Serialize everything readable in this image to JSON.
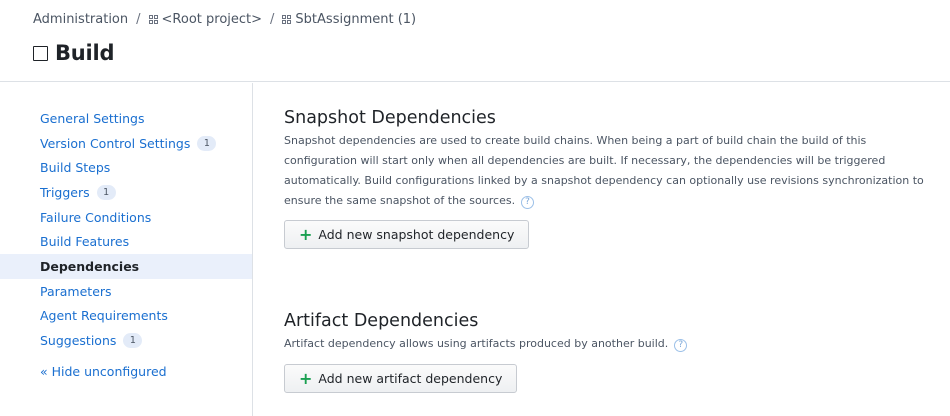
{
  "breadcrumb": {
    "items": [
      {
        "label": "Administration"
      },
      {
        "label": "<Root project>"
      },
      {
        "label": "SbtAssignment (1)"
      }
    ],
    "separator": "/"
  },
  "page": {
    "title": "Build"
  },
  "sidebar": {
    "items": [
      {
        "label": "General Settings",
        "count": ""
      },
      {
        "label": "Version Control Settings",
        "count": "1"
      },
      {
        "label": "Build Steps",
        "count": ""
      },
      {
        "label": "Triggers",
        "count": "1"
      },
      {
        "label": "Failure Conditions",
        "count": ""
      },
      {
        "label": "Build Features",
        "count": ""
      },
      {
        "label": "Dependencies",
        "count": "",
        "active": true
      },
      {
        "label": "Parameters",
        "count": ""
      },
      {
        "label": "Agent Requirements",
        "count": ""
      },
      {
        "label": "Suggestions",
        "count": "1"
      }
    ],
    "hide_link": "« Hide unconfigured"
  },
  "snapshot": {
    "title": "Snapshot Dependencies",
    "description": "Snapshot dependencies are used to create build chains. When being a part of build chain the build of this configuration will start only when all dependencies are built. If necessary, the dependencies will be triggered automatically. Build configurations linked by a snapshot dependency can optionally use revisions synchronization to ensure the same snapshot of the sources.",
    "button": "Add new snapshot dependency"
  },
  "artifact": {
    "title": "Artifact Dependencies",
    "description": "Artifact dependency allows using artifacts produced by another build.",
    "button": "Add new artifact dependency"
  },
  "icons": {
    "help": "?",
    "plus": "+"
  },
  "colors": {
    "link": "#1a6fd0",
    "add": "#1aa051",
    "active_bg": "#eaf0fb"
  }
}
